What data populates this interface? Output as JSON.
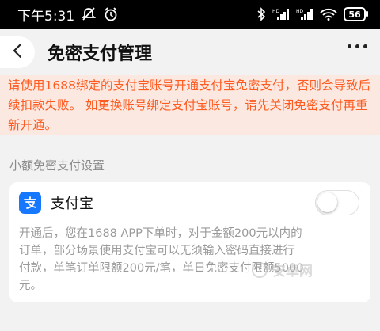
{
  "status_bar": {
    "time": "下午5:31",
    "battery": "56",
    "icons": [
      "mute-icon",
      "alarm-icon",
      "bluetooth-icon",
      "signal-hd-icon",
      "signal-hd-icon",
      "wifi-icon",
      "battery-icon"
    ]
  },
  "header": {
    "title": "免密支付管理"
  },
  "notice": {
    "text": "请使用1688绑定的支付宝账号开通支付宝免密支付，否则会导致后续扣款失败。 如更换账号绑定支付宝账号，请先关闭免密支付再重新开通。"
  },
  "section": {
    "label": "小额免密支付设置"
  },
  "provider": {
    "name": "支付宝",
    "enabled": false,
    "description": "开通后，您在1688 APP下单时，对于金额200元以内的订单，部分场景使用支付宝可以无须输入密码直接进行付款，单笔订单限额200元/笔，单日免密支付限额5000元。"
  },
  "watermark": {
    "text": "安卓网"
  },
  "colors": {
    "notice_text": "#ff5a1f",
    "notice_bg": "#fbe9e1",
    "alipay_blue": "#1677ff"
  }
}
